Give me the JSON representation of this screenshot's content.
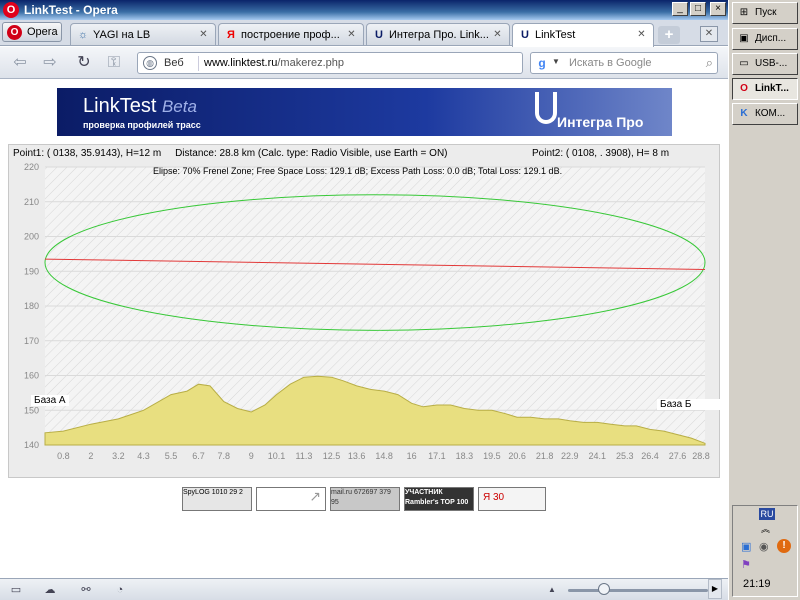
{
  "window": {
    "title": "LinkTest - Opera",
    "buttons": [
      "_",
      "□",
      "×"
    ]
  },
  "menu_button": "Opera",
  "tabs": [
    {
      "label": "YAGI на LB",
      "icon": "☼"
    },
    {
      "label": "построение проф...",
      "icon": "Я"
    },
    {
      "label": "Интегра Про. Link...",
      "icon": "U"
    },
    {
      "label": "LinkTest",
      "icon": "U",
      "active": true
    }
  ],
  "navbar": {
    "web_label": "Веб",
    "url_host": "www.linktest.ru",
    "url_path": "/makerez.php",
    "search_placeholder": "Искать в Google"
  },
  "banner": {
    "title": "LinkTest",
    "beta": "Beta",
    "subtitle": "проверка профилей трасс",
    "brand": "Интегра Про"
  },
  "profile": {
    "point1": "Point1: (     0138, 35.9143), H=12  m",
    "distance": "Distance: 28.8 km  (Calc. type: Radio Visible, use Earth = ON)",
    "point2": "Point2: (     0108, .    3908), H=  8      m",
    "summary": "Elipse: 70% Frenel Zone;  Free Space Loss: 129.1 dB;  Excess Path Loss: 0.0 dB;   Total Loss: 129.1 dB.",
    "base_a": "База А",
    "base_b": "База Б"
  },
  "chart_data": {
    "type": "area",
    "x_ticks": [
      "0.8",
      "2",
      "3.2",
      "4.3",
      "5.5",
      "6.7",
      "7.8",
      "9",
      "10.1",
      "11.3",
      "12.5",
      "13.6",
      "14.8",
      "16",
      "17.1",
      "18.3",
      "19.5",
      "20.6",
      "21.8",
      "22.9",
      "24.1",
      "25.3",
      "26.4",
      "27.6",
      "28.8"
    ],
    "y_ticks": [
      "140",
      "150",
      "160",
      "170",
      "180",
      "190",
      "200",
      "210",
      "220"
    ],
    "ylim": [
      140,
      220
    ],
    "xlim": [
      0,
      28.8
    ],
    "terrain": {
      "x": [
        0,
        0.8,
        2,
        3.2,
        4.3,
        5.5,
        6.2,
        6.7,
        7.2,
        7.8,
        8.4,
        9,
        9.6,
        10.1,
        10.7,
        11.3,
        11.9,
        12.5,
        13,
        13.6,
        14.2,
        14.8,
        15.4,
        16,
        16.5,
        17.1,
        17.7,
        18.3,
        18.9,
        19.5,
        20.1,
        20.6,
        21.2,
        21.8,
        22.4,
        22.9,
        23.5,
        24.1,
        24.7,
        25.3,
        25.8,
        26.4,
        27,
        27.6,
        28.2,
        28.8
      ],
      "y": [
        143.5,
        144,
        146,
        147.5,
        150,
        154.5,
        155.5,
        157.5,
        157,
        152.5,
        150.5,
        149.5,
        151.5,
        154.5,
        157.5,
        159.5,
        159.8,
        159.5,
        158.5,
        157,
        156,
        155.5,
        154.5,
        152,
        151,
        151.5,
        151.5,
        150.5,
        150,
        150,
        149,
        148,
        148,
        147.5,
        147.5,
        147,
        146.5,
        146.5,
        146,
        145.5,
        145.5,
        144.5,
        144,
        143,
        142,
        140.5
      ]
    },
    "los_line": {
      "x": [
        0,
        28.8
      ],
      "y": [
        193.5,
        190.5
      ]
    },
    "fresnel": {
      "center_y": 192.5,
      "semi_height": 19.5
    },
    "colors": {
      "terrain": "#e8df80",
      "terrain_edge": "#b8ae46",
      "los": "#e23838",
      "fresnel": "#38c838"
    }
  },
  "counters": [
    {
      "name": "spylog-counter",
      "text": "SpyLOG 1010 29 2"
    },
    {
      "name": "blank-counter",
      "text": ""
    },
    {
      "name": "mail-counter",
      "text": "mail.ru 672697 379 95"
    },
    {
      "name": "rambler-counter",
      "text": "УЧАСТНИК Rambler's TOP 100"
    },
    {
      "name": "yandex-counter",
      "text": "Я 30"
    }
  ],
  "taskbar": {
    "items": [
      {
        "label": "Пуск",
        "icon": "⊞"
      },
      {
        "label": "Дисп...",
        "icon": "▣"
      },
      {
        "label": "USB-...",
        "icon": "▭"
      },
      {
        "label": "LinkT...",
        "icon": "O",
        "active": true
      },
      {
        "label": "КОМ...",
        "icon": "K"
      }
    ],
    "lang": "RU",
    "clock": "21:19"
  }
}
